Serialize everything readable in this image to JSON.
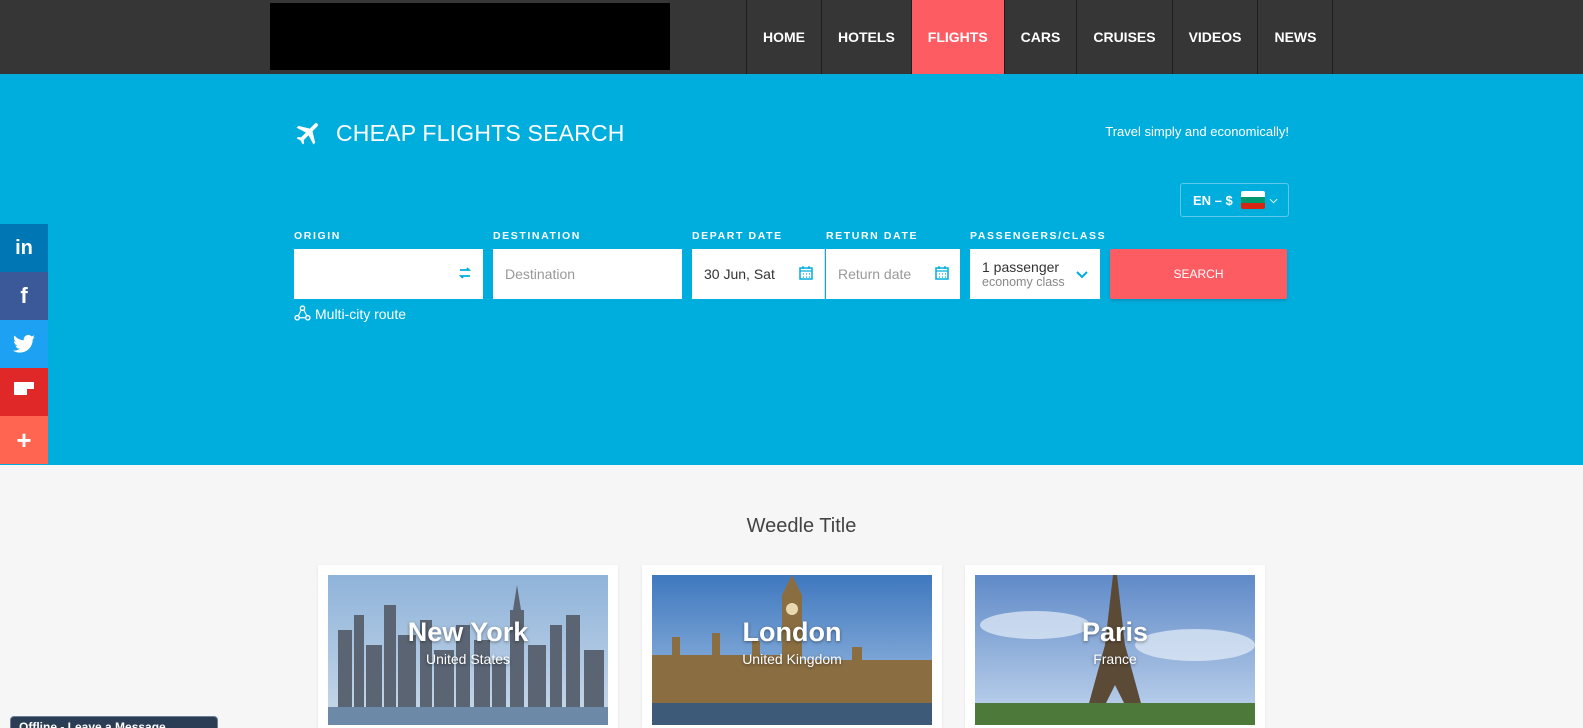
{
  "nav": {
    "items": [
      {
        "label": "HOME"
      },
      {
        "label": "HOTELS"
      },
      {
        "label": "FLIGHTS"
      },
      {
        "label": "CARS"
      },
      {
        "label": "CRUISES"
      },
      {
        "label": "VIDEOS"
      },
      {
        "label": "NEWS"
      }
    ],
    "active": "FLIGHTS"
  },
  "hero": {
    "title": "CHEAP FLIGHTS SEARCH",
    "tagline": "Travel simply and economically!",
    "lang": "EN – $"
  },
  "search": {
    "origin_label": "ORIGIN",
    "origin_value": "",
    "destination_label": "DESTINATION",
    "destination_placeholder": "Destination",
    "depart_label": "DEPART DATE",
    "depart_value": "30 Jun, Sat",
    "return_label": "RETURN DATE",
    "return_placeholder": "Return date",
    "passengers_label": "PASSENGERS/CLASS",
    "passengers_value": "1 passenger",
    "class_value": "economy class",
    "button": "SEARCH",
    "multicity": "Multi-city route"
  },
  "social": {
    "linkedin": "in",
    "facebook": "f",
    "twitter": "twitter-icon",
    "flipboard": "flipboard-icon",
    "more": "+"
  },
  "section": {
    "title": "Weedle Title",
    "cards": [
      {
        "city": "New York",
        "country": "United States"
      },
      {
        "city": "London",
        "country": "United Kingdom"
      },
      {
        "city": "Paris",
        "country": "France"
      }
    ]
  },
  "chat": {
    "label": "Offline - Leave a Message"
  },
  "colors": {
    "topbar": "#363636",
    "hero": "#00aede",
    "accent": "#fd5c63"
  }
}
